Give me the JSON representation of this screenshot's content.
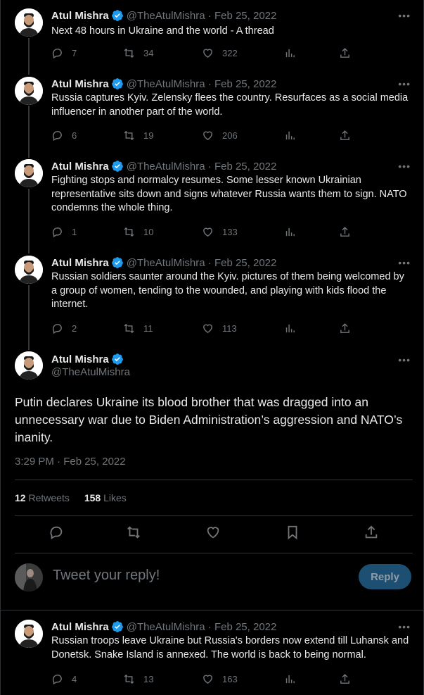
{
  "author": {
    "name": "Atul Mishra",
    "handle": "@TheAtulMishra",
    "verified": true
  },
  "colors": {
    "background": "#000000",
    "text": "#e7e9ea",
    "muted": "#71767b",
    "verified_badge": "#1d9bf0",
    "reply_button": "#1d4f73"
  },
  "thread": [
    {
      "meta": "@TheAtulMishra · Feb 25, 2022",
      "text": "Next 48 hours in Ukraine and the world - A thread",
      "replies": "7",
      "retweets": "34",
      "likes": "322"
    },
    {
      "meta": "@TheAtulMishra · Feb 25, 2022",
      "text": "Russia captures Kyiv. Zelensky flees the country. Resurfaces as a social media influencer in another part of the world.",
      "replies": "6",
      "retweets": "19",
      "likes": "206"
    },
    {
      "meta": "@TheAtulMishra · Feb 25, 2022",
      "text": "Fighting stops and normalcy resumes. Some lesser known Ukrainian representative sits down and signs whatever Russia wants them to sign. NATO condemns the whole thing.",
      "replies": "1",
      "retweets": "10",
      "likes": "133"
    },
    {
      "meta": "@TheAtulMishra · Feb 25, 2022",
      "text": "Russian soldiers saunter around the Kyiv. pictures of them being welcomed by a group of women, tending to the wounded, and playing with kids flood the internet.",
      "replies": "2",
      "retweets": "11",
      "likes": "113"
    }
  ],
  "main_tweet": {
    "text": "Putin declares Ukraine its blood brother that was dragged into an unnecessary war due to Biden Administration’s aggression and NATO’s inanity.",
    "timestamp": "3:29 PM · Feb 25, 2022",
    "retweets_count": "12",
    "retweets_label": "Retweets",
    "likes_count": "158",
    "likes_label": "Likes"
  },
  "reply_box": {
    "placeholder": "Tweet your reply!",
    "button_label": "Reply"
  },
  "next_tweet": {
    "meta": "@TheAtulMishra · Feb 25, 2022",
    "text": "Russian troops leave Ukraine but Russia's borders now extend till Luhansk and Donetsk. Snake Island is annexed. The world is back to being normal.",
    "replies": "4",
    "retweets": "13",
    "likes": "163"
  },
  "more_icon": "ellipsis-icon"
}
